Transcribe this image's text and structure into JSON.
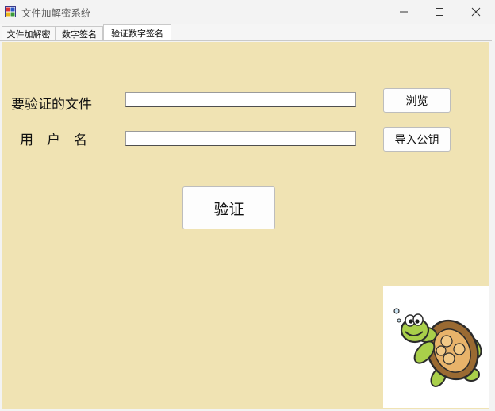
{
  "window": {
    "title": "文件加解密系统"
  },
  "tabs": [
    {
      "label": "文件加解密",
      "active": false
    },
    {
      "label": "数字签名",
      "active": false
    },
    {
      "label": "验证数字签名",
      "active": true
    }
  ],
  "form": {
    "file_label": "要验证的文件",
    "file_value": "",
    "user_label": "用　户　名",
    "user_value": "",
    "browse_button": "浏览",
    "import_key_button": "导入公钥",
    "verify_button": "验证"
  },
  "colors": {
    "panel_bg": "#f0e3b3",
    "titlebar_bg": "#f3f3f3"
  },
  "icons": [
    "app-icon",
    "minimize-icon",
    "maximize-icon",
    "close-icon",
    "turtle-image"
  ]
}
